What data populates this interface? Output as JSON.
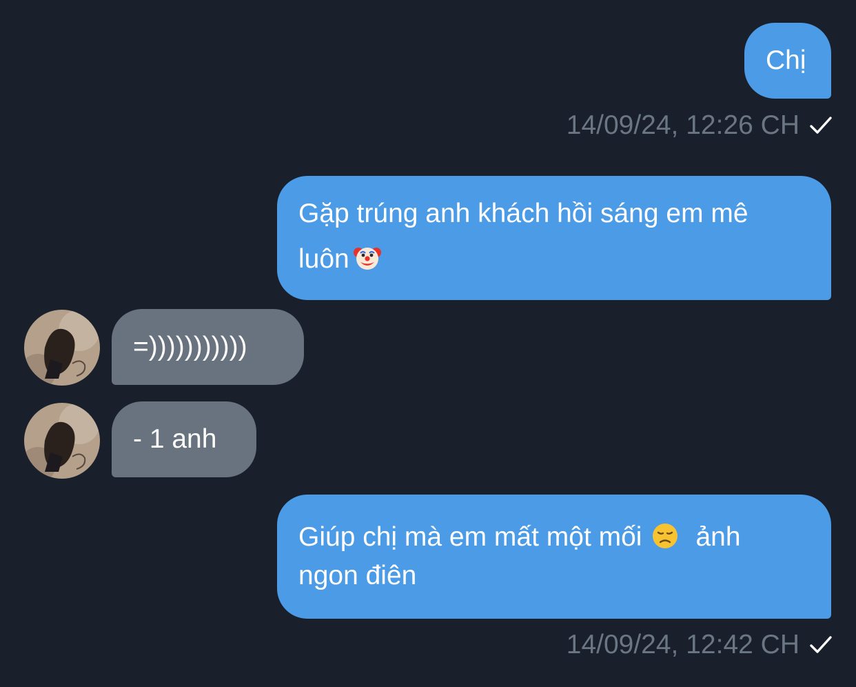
{
  "messages": [
    {
      "direction": "outgoing",
      "text": "Chị"
    },
    {
      "direction": "outgoing",
      "timestamp": "14/09/24, 12:26 CH",
      "status": "sent"
    },
    {
      "direction": "outgoing",
      "text_line1": "Gặp trúng anh khách hồi sáng em mê",
      "text_line2": "luôn",
      "emoji": "clown-face-emoji"
    },
    {
      "direction": "incoming",
      "text": "=)))))))))))",
      "avatar": "avatar"
    },
    {
      "direction": "incoming",
      "text": "- 1 anh",
      "avatar": "avatar"
    },
    {
      "direction": "outgoing",
      "text_line1_before": "Giúp chị mà em mất một mối",
      "emoji": "disappointed-face-emoji",
      "text_line1_after": "ảnh",
      "text_line2": "ngon điên"
    },
    {
      "direction": "outgoing",
      "timestamp": "14/09/24, 12:42 CH",
      "status": "sent"
    }
  ],
  "colors": {
    "background": "#19202b",
    "outgoing_bubble": "#4c9be7",
    "incoming_bubble": "#68737f",
    "timestamp": "#6b7684",
    "text": "#ffffff"
  }
}
